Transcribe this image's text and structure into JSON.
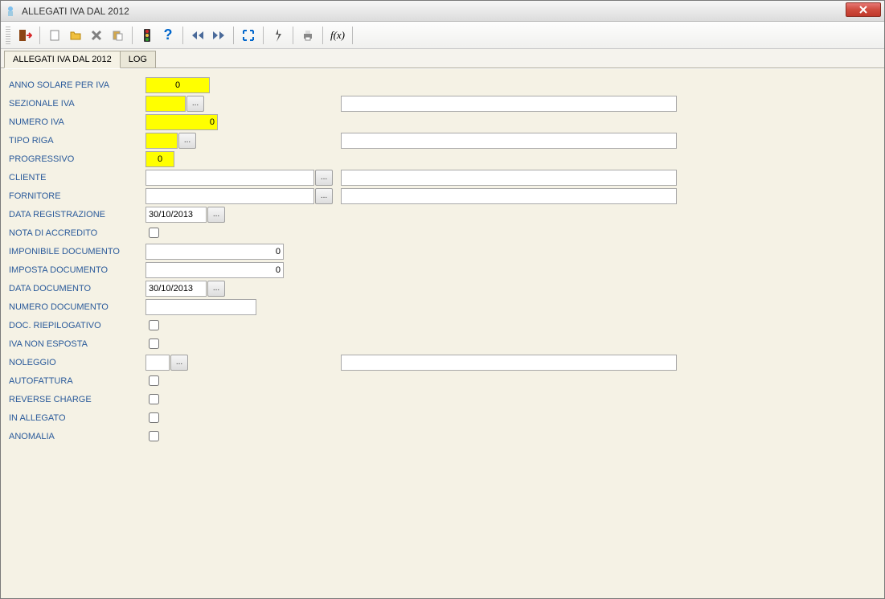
{
  "window": {
    "title": "ALLEGATI IVA DAL 2012"
  },
  "toolbar": {
    "icons": {
      "exit": "exit-icon",
      "new": "new-icon",
      "open": "open-icon",
      "delete": "delete-icon",
      "paste": "paste-icon",
      "traffic": "traffic-icon",
      "help": "?",
      "prev": "◄◄",
      "next": "►►",
      "fullscreen": "fullscreen-icon",
      "script": "script-icon",
      "print": "print-icon",
      "fx": "f(x)"
    }
  },
  "tabs": [
    {
      "label": "ALLEGATI IVA DAL 2012",
      "active": true
    },
    {
      "label": "LOG",
      "active": false
    }
  ],
  "form": {
    "anno_label": "ANNO SOLARE PER IVA",
    "anno_value": "0",
    "sezionale_label": "SEZIONALE IVA",
    "sezionale_value": "",
    "sezionale_desc": "",
    "numero_label": "NUMERO IVA",
    "numero_value": "0",
    "tipo_label": "TIPO RIGA",
    "tipo_value": "",
    "tipo_desc": "",
    "progressivo_label": "PROGRESSIVO",
    "progressivo_value": "0",
    "cliente_label": "CLIENTE",
    "cliente_value": "",
    "cliente_desc": "",
    "fornitore_label": "FORNITORE",
    "fornitore_value": "",
    "fornitore_desc": "",
    "datareg_label": "DATA REGISTRAZIONE",
    "datareg_value": "30/10/2013",
    "nota_label": "NOTA DI ACCREDITO",
    "imponibile_label": "IMPONIBILE DOCUMENTO",
    "imponibile_value": "0",
    "imposta_label": "IMPOSTA DOCUMENTO",
    "imposta_value": "0",
    "datadoc_label": "DATA DOCUMENTO",
    "datadoc_value": "30/10/2013",
    "numdoc_label": "NUMERO DOCUMENTO",
    "numdoc_value": "",
    "riepilog_label": "DOC. RIEPILOGATIVO",
    "ivanon_label": "IVA NON ESPOSTA",
    "noleggio_label": "NOLEGGIO",
    "noleggio_value": "",
    "noleggio_desc": "",
    "autofattura_label": "AUTOFATTURA",
    "reverse_label": "REVERSE CHARGE",
    "inallegato_label": "IN ALLEGATO",
    "anomalia_label": "ANOMALIA"
  },
  "lookup_btn_label": "..."
}
